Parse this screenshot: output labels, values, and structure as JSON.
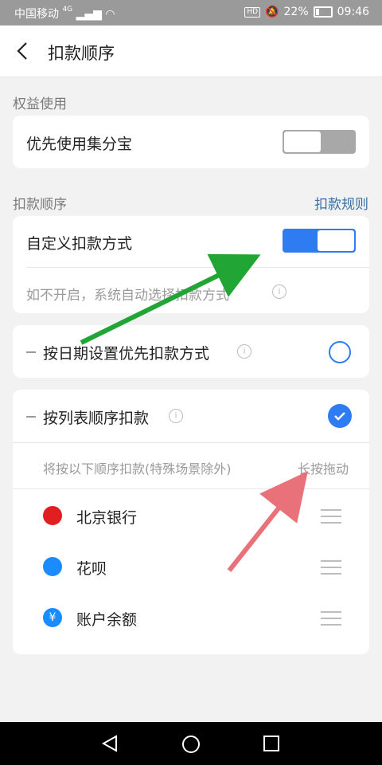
{
  "status_bar": {
    "carrier": "中国移动",
    "network": "4G",
    "battery": "22%",
    "time": "09:46"
  },
  "header": {
    "title": "扣款顺序"
  },
  "rights": {
    "section_label": "权益使用",
    "use_jifenbao_label": "优先使用集分宝",
    "use_jifenbao_on": false
  },
  "deduction": {
    "section_label": "扣款顺序",
    "rules_link": "扣款规则",
    "custom_label": "自定义扣款方式",
    "custom_on": true,
    "hint": "如不开启，系统自动选择扣款方式",
    "by_date_label": "按日期设置优先扣款方式",
    "by_list_label": "按列表顺序扣款",
    "list_hint": "将按以下顺序扣款(特殊场景除外)",
    "long_press_label": "长按拖动",
    "methods": [
      {
        "name": "北京银行",
        "icon": "bank-of-beijing-icon",
        "color": "#e02020"
      },
      {
        "name": "花呗",
        "icon": "huabei-icon",
        "color": "#1a8cff"
      },
      {
        "name": "账户余额",
        "icon": "balance-icon",
        "color": "#1a8cff"
      }
    ]
  },
  "annotations": {
    "green_arrow_color": "#21a636",
    "red_arrow_color": "#e9727a"
  }
}
